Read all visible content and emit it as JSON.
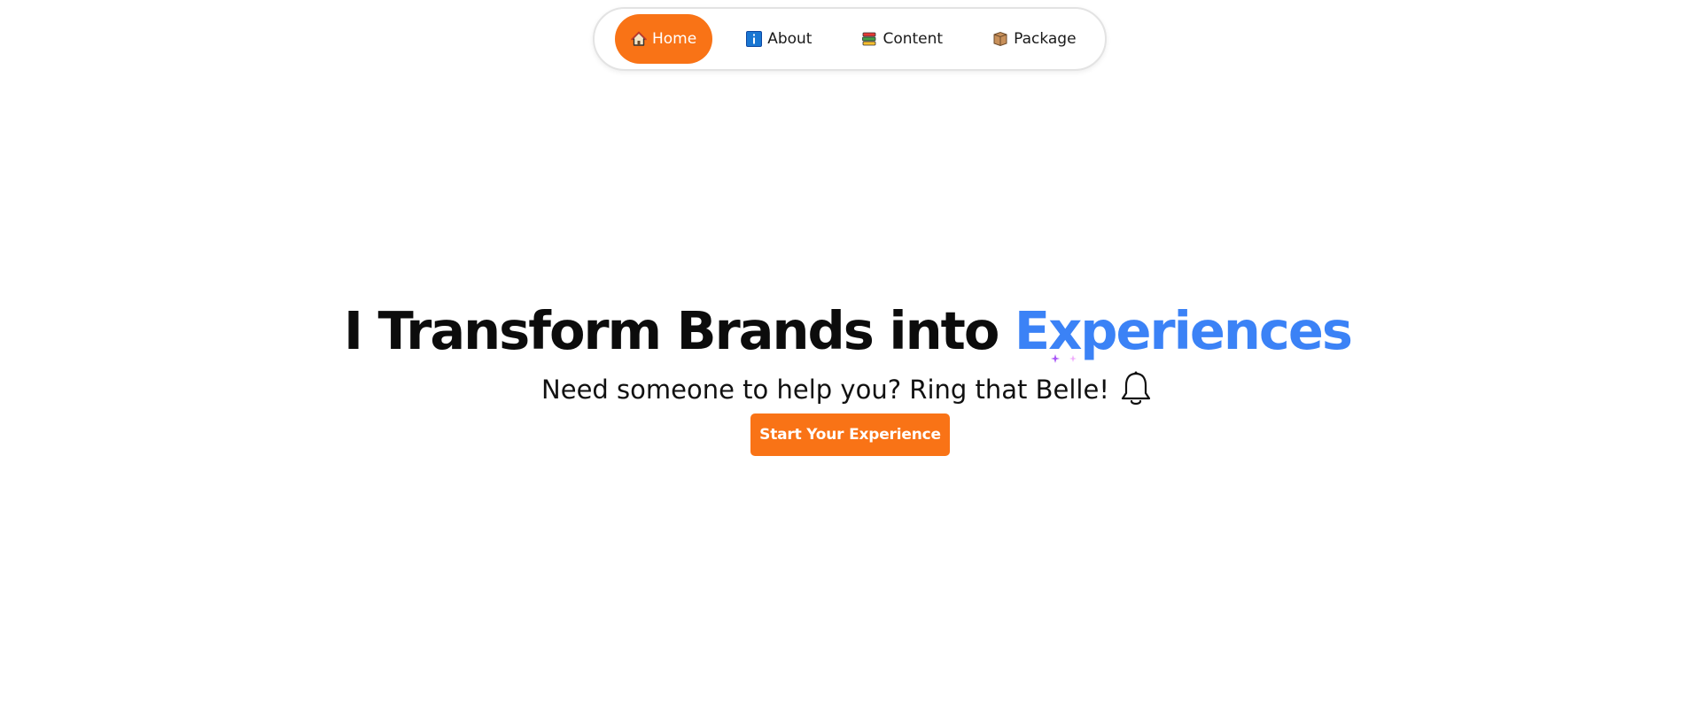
{
  "nav": {
    "items": [
      {
        "label": "Home",
        "icon": "house-icon",
        "active": true
      },
      {
        "label": "About",
        "icon": "info-icon",
        "active": false
      },
      {
        "label": "Content",
        "icon": "books-icon",
        "active": false
      },
      {
        "label": "Package",
        "icon": "package-icon",
        "active": false
      }
    ]
  },
  "hero": {
    "title_main": "I Transform Brands into ",
    "title_accent": "Experiences",
    "subtitle": "Need someone to help you? Ring that Belle!",
    "cta_label": "Start Your Experience"
  },
  "colors": {
    "accent": "#f97316",
    "highlight": "#3b82f6",
    "text": "#0c0c0c"
  }
}
